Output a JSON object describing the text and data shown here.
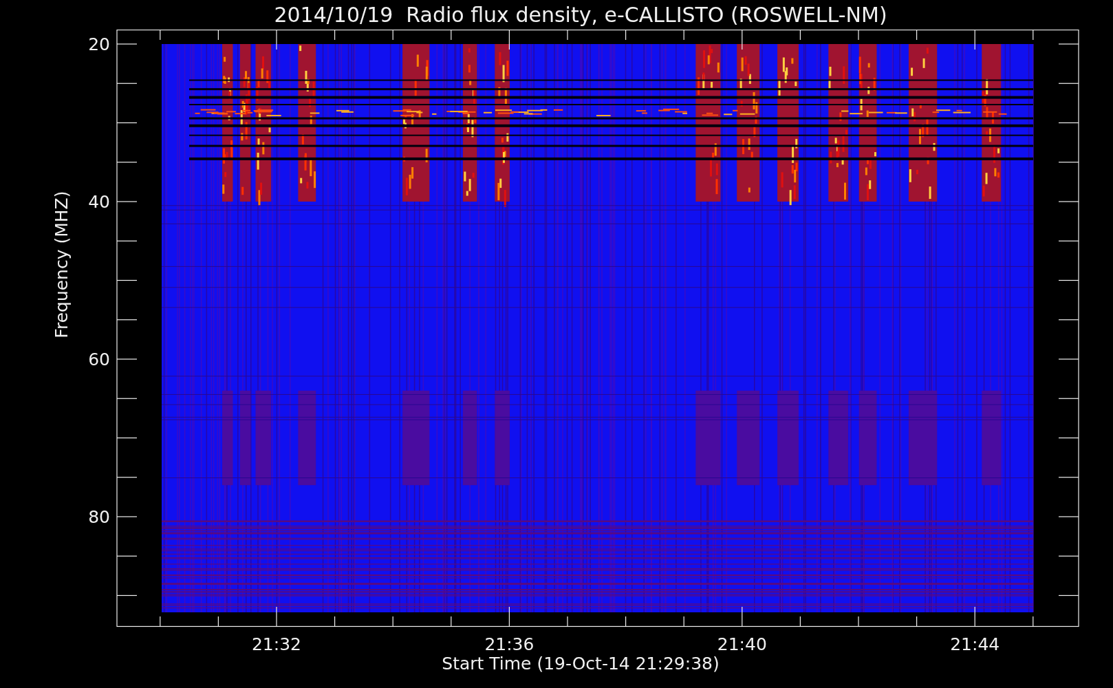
{
  "title": "2014/10/19  Radio flux density, e-CALLISTO (ROSWELL-NM)",
  "y_axis": {
    "label": "Frequency (MHZ)",
    "ticks": [
      "20",
      "40",
      "60",
      "80"
    ]
  },
  "x_axis": {
    "label": "Start Time (19-Oct-14 21:29:38)",
    "ticks": [
      "21:32",
      "21:36",
      "21:40",
      "21:44"
    ]
  }
}
